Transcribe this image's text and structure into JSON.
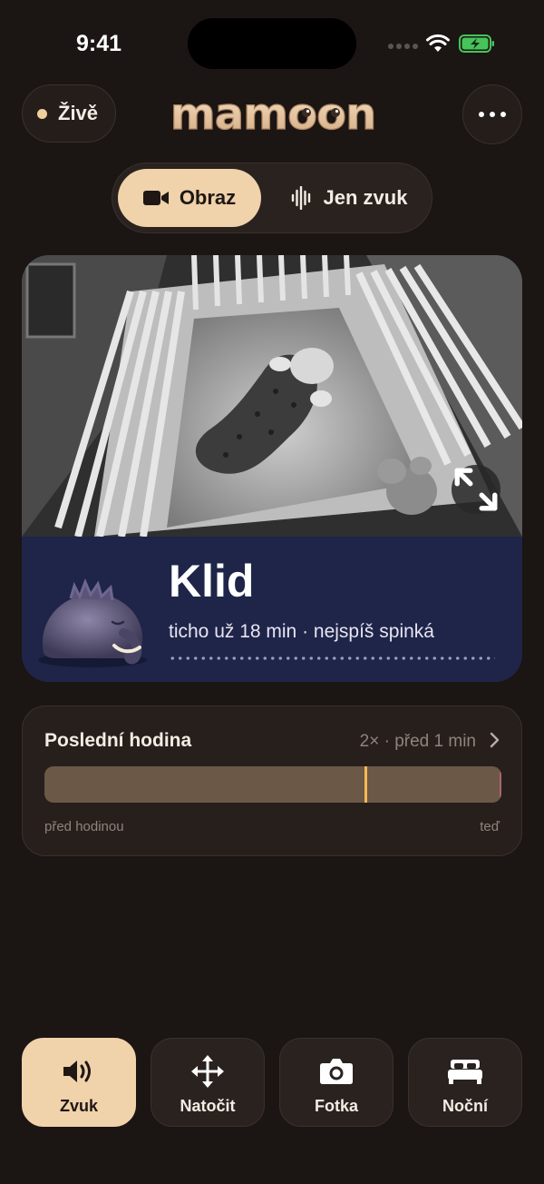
{
  "status_bar": {
    "time": "9:41"
  },
  "header": {
    "live_label": "Živě",
    "logo_text": "mamoon",
    "more_icon": "ellipsis-icon"
  },
  "view_mode": {
    "options": [
      {
        "label": "Obraz",
        "icon": "video-camera-icon",
        "selected": true
      },
      {
        "label": "Jen zvuk",
        "icon": "waveform-icon",
        "selected": false
      }
    ]
  },
  "camera": {
    "expand_icon": "expand-icon"
  },
  "status": {
    "title": "Klid",
    "subtitle": "ticho už 18 min · nejspíš spinká",
    "colors": {
      "panel": "#1e2549"
    }
  },
  "last_hour": {
    "title": "Poslední hodina",
    "meta": "2× · před 1 min",
    "start_label": "před hodinou",
    "end_label": "teď",
    "event_position": 0.7,
    "colors": {
      "bar": "#6b5847",
      "event": "#f5b955"
    }
  },
  "actions": [
    {
      "label": "Zvuk",
      "icon": "speaker-icon",
      "active": true
    },
    {
      "label": "Natočit",
      "icon": "move-arrows-icon",
      "active": false
    },
    {
      "label": "Fotka",
      "icon": "camera-icon",
      "active": false
    },
    {
      "label": "Noční",
      "icon": "bed-icon",
      "active": false
    }
  ],
  "theme": {
    "accent": "#f0d2ab",
    "background": "#1b1513"
  }
}
